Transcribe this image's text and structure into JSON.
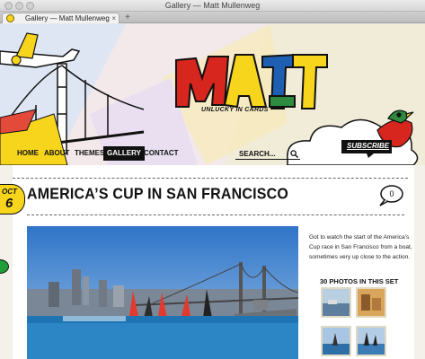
{
  "window": {
    "title": "Gallery — Matt Mullenweg"
  },
  "tab": {
    "label": "Gallery — Matt Mullenweg",
    "close": "×",
    "new_tab": "+"
  },
  "site": {
    "logo_text": "MATT",
    "tagline": "UNLUCKY IN CARDS"
  },
  "nav": {
    "items": [
      "HOME",
      "ABOUT",
      "THEMES",
      "GALLERY",
      "CONTACT"
    ],
    "active": "GALLERY"
  },
  "search": {
    "placeholder": "SEARCH..."
  },
  "subscribe": "SUBSCRIBE",
  "post": {
    "date_month": "OCT",
    "date_day": "6",
    "title": "AMERICA’S CUP IN SAN FRANCISCO",
    "excerpt": "Got to watch the start of the America’s Cup race in San Francisco from a boat, sometimes very up close to the action.",
    "set_title": "30 PHOTOS IN THIS SET"
  },
  "colors": {
    "accent_yellow": "#f7d51d",
    "accent_red": "#d7261e",
    "accent_blue": "#1e5fb3",
    "ink": "#111111"
  }
}
